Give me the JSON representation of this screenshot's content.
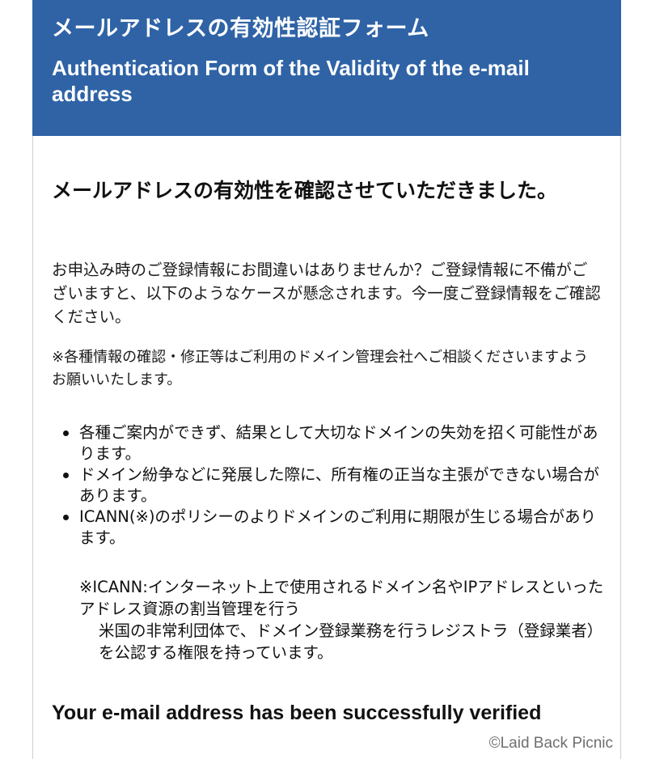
{
  "header": {
    "title_ja": "メールアドレスの有効性認証フォーム",
    "title_en": "Authentication Form of the Validity of the e-mail address"
  },
  "main": {
    "headline_ja": "メールアドレスの有効性を確認させていただきました。",
    "paragraph_1": "お申込み時のご登録情報にお間違いはありませんか？ご登録情報に不備がございますと、以下のようなケースが懸念されます。今一度ご登録情報をご確認ください。",
    "paragraph_2": "※各種情報の確認・修正等はご利用のドメイン管理会社へご相談くださいますようお願いいたします。",
    "bullets": [
      "各種ご案内ができず、結果として大切なドメインの失効を招く可能性があります。",
      "ドメイン紛争などに発展した際に、所有権の正当な主張ができない場合があります。",
      "ICANN(※)のポリシーのよりドメインのご利用に期限が生じる場合があります。"
    ],
    "icann_note_line_1": "※ICANN:インターネット上で使用されるドメイン名やIPアドレスといったアドレス資源の割当管理を行う",
    "icann_note_line_2": "米国の非常利団体で、ドメイン登録業務を行うレジストラ（登録業者）を公認する権限を持っています。",
    "success_en": "Your e-mail address has been successfully verified"
  },
  "watermark": "©Laid Back Picnic",
  "colors": {
    "header_background": "#2f63a6",
    "header_text": "#ffffff",
    "body_text": "#111111",
    "watermark_text": "#6f6f6f"
  }
}
